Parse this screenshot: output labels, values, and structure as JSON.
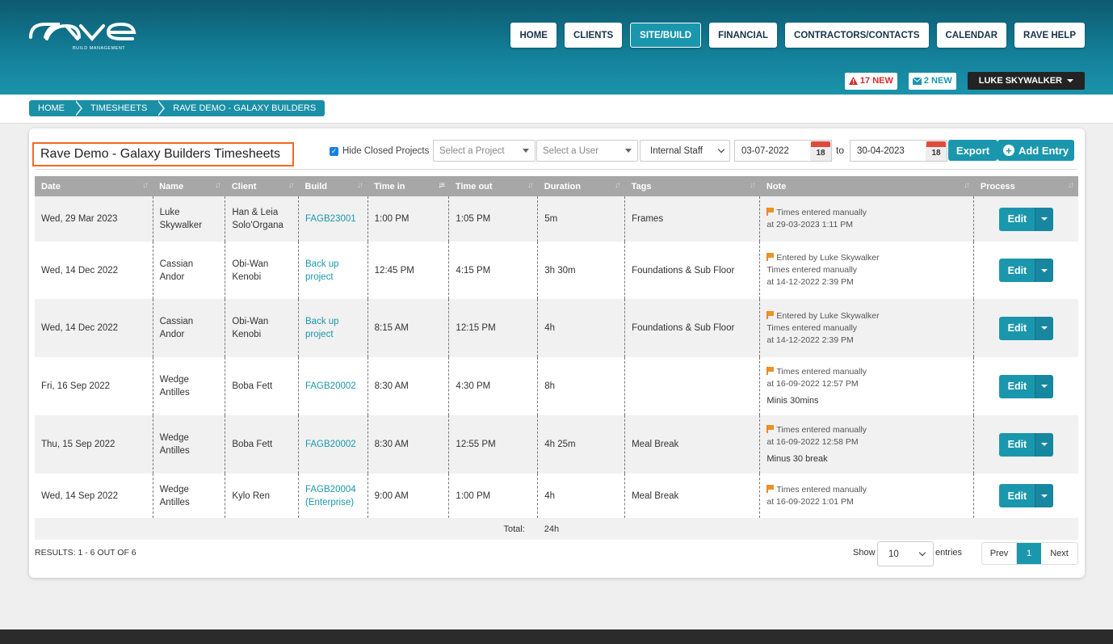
{
  "brand": {
    "logo_text": "rave",
    "tagline": "BUILD MANAGEMENT"
  },
  "nav": [
    {
      "label": "HOME"
    },
    {
      "label": "CLIENTS"
    },
    {
      "label": "SITE/BUILD",
      "active": true
    },
    {
      "label": "FINANCIAL"
    },
    {
      "label": "CONTRACTORS/CONTACTS"
    },
    {
      "label": "CALENDAR"
    },
    {
      "label": "RAVE HELP"
    }
  ],
  "alerts": {
    "warnings": "17 NEW",
    "messages": "2 NEW",
    "user": "LUKE SKYWALKER"
  },
  "breadcrumb": [
    "HOME",
    "TIMESHEETS",
    "RAVE DEMO - GALAXY BUILDERS"
  ],
  "page_title": "Rave Demo - Galaxy Builders Timesheets",
  "filters": {
    "hide_closed_label": "Hide Closed Projects",
    "hide_closed_checked": true,
    "project_placeholder": "Select a Project",
    "user_placeholder": "Select a User",
    "staff_type": "Internal Staff",
    "date_from": "03-07-2022",
    "to_label": "to",
    "date_to": "30-04-2023",
    "calendar_day": "18",
    "export_label": "Export",
    "add_entry_label": "Add Entry"
  },
  "table": {
    "columns": [
      "Date",
      "Name",
      "Client",
      "Build",
      "Time in",
      "Time out",
      "Duration",
      "Tags",
      "Note",
      "Process"
    ],
    "rows": [
      {
        "date": "Wed, 29 Mar 2023",
        "name": "Luke Skywalker",
        "client": "Han & Leia Solo'Organa",
        "build": "FAGB23001",
        "time_in": "1:00 PM",
        "time_out": "1:05 PM",
        "duration": "5m",
        "tags": "Frames",
        "note_lines": [
          "Times entered manually",
          "at 29-03-2023 1:11 PM"
        ],
        "note_extra": "",
        "edit": "Edit"
      },
      {
        "date": "Wed, 14 Dec 2022",
        "name": "Cassian Andor",
        "client": "Obi-Wan Kenobi",
        "build": "Back up project",
        "time_in": "12:45 PM",
        "time_out": "4:15 PM",
        "duration": "3h 30m",
        "tags": "Foundations & Sub Floor",
        "note_lines": [
          "Entered by Luke Skywalker",
          "Times entered manually",
          "at 14-12-2022 2:39 PM"
        ],
        "note_extra": "",
        "edit": "Edit"
      },
      {
        "date": "Wed, 14 Dec 2022",
        "name": "Cassian Andor",
        "client": "Obi-Wan Kenobi",
        "build": "Back up project",
        "time_in": "8:15 AM",
        "time_out": "12:15 PM",
        "duration": "4h",
        "tags": "Foundations & Sub Floor",
        "note_lines": [
          "Entered by Luke Skywalker",
          "Times entered manually",
          "at 14-12-2022 2:39 PM"
        ],
        "note_extra": "",
        "edit": "Edit"
      },
      {
        "date": "Fri, 16 Sep 2022",
        "name": "Wedge Antilles",
        "client": "Boba Fett",
        "build": "FAGB20002",
        "time_in": "8:30 AM",
        "time_out": "4:30 PM",
        "duration": "8h",
        "tags": "",
        "note_lines": [
          "Times entered manually",
          "at 16-09-2022 12:57 PM"
        ],
        "note_extra": "Minis 30mins",
        "edit": "Edit"
      },
      {
        "date": "Thu, 15 Sep 2022",
        "name": "Wedge Antilles",
        "client": "Boba Fett",
        "build": "FAGB20002",
        "time_in": "8:30 AM",
        "time_out": "12:55 PM",
        "duration": "4h 25m",
        "tags": "Meal Break",
        "note_lines": [
          "Times entered manually",
          "at 16-09-2022 12:58 PM"
        ],
        "note_extra": "Minus 30 break",
        "edit": "Edit"
      },
      {
        "date": "Wed, 14 Sep 2022",
        "name": "Wedge Antilles",
        "client": "Kylo Ren",
        "build": "FAGB20004 (Enterprise)",
        "time_in": "9:00 AM",
        "time_out": "1:00 PM",
        "duration": "4h",
        "tags": "Meal Break",
        "note_lines": [
          "Times entered manually",
          "at 16-09-2022 1:01 PM"
        ],
        "note_extra": "",
        "edit": "Edit"
      }
    ],
    "total_label": "Total:",
    "total_value": "24h"
  },
  "footer_bar": {
    "results": "RESULTS: 1 - 6 OUT OF 6",
    "show_label": "Show",
    "page_size": "10",
    "entries_label": "entries",
    "prev": "Prev",
    "page": "1",
    "next": "Next"
  },
  "colors": {
    "accent": "#1a97ad",
    "header_dark": "#0d5a70",
    "alert_red": "#d62a2a",
    "title_outline": "#f06a22",
    "table_header": "#a7a7a7"
  }
}
